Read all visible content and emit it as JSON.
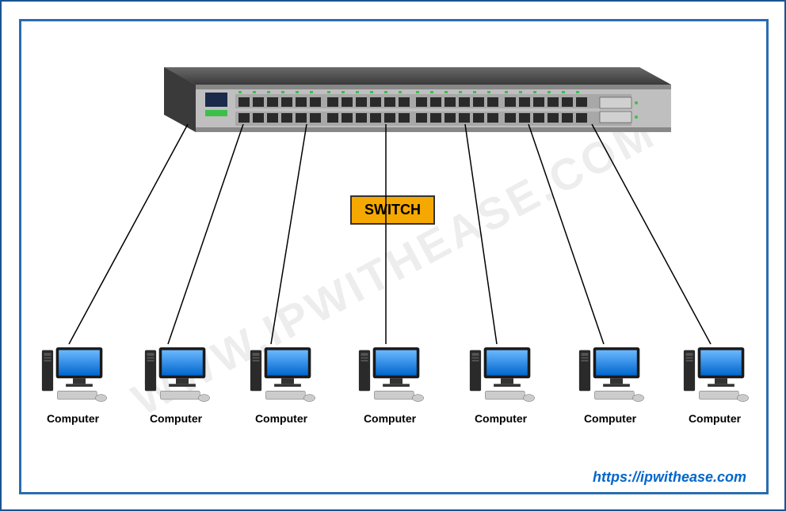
{
  "diagram": {
    "title": "SWITCH",
    "device": "switch",
    "watermark": "WWW.IPWITHEASE.COM",
    "url": "https://ipwithease.com",
    "nodes": [
      {
        "label": "Computer"
      },
      {
        "label": "Computer"
      },
      {
        "label": "Computer"
      },
      {
        "label": "Computer"
      },
      {
        "label": "Computer"
      },
      {
        "label": "Computer"
      },
      {
        "label": "Computer"
      }
    ],
    "topology": "star",
    "description": "Seven computers connected to a single network switch in a star topology"
  },
  "colors": {
    "frame": "#2a6cb0",
    "label_bg": "#f5a800",
    "link": "#0066cc"
  }
}
